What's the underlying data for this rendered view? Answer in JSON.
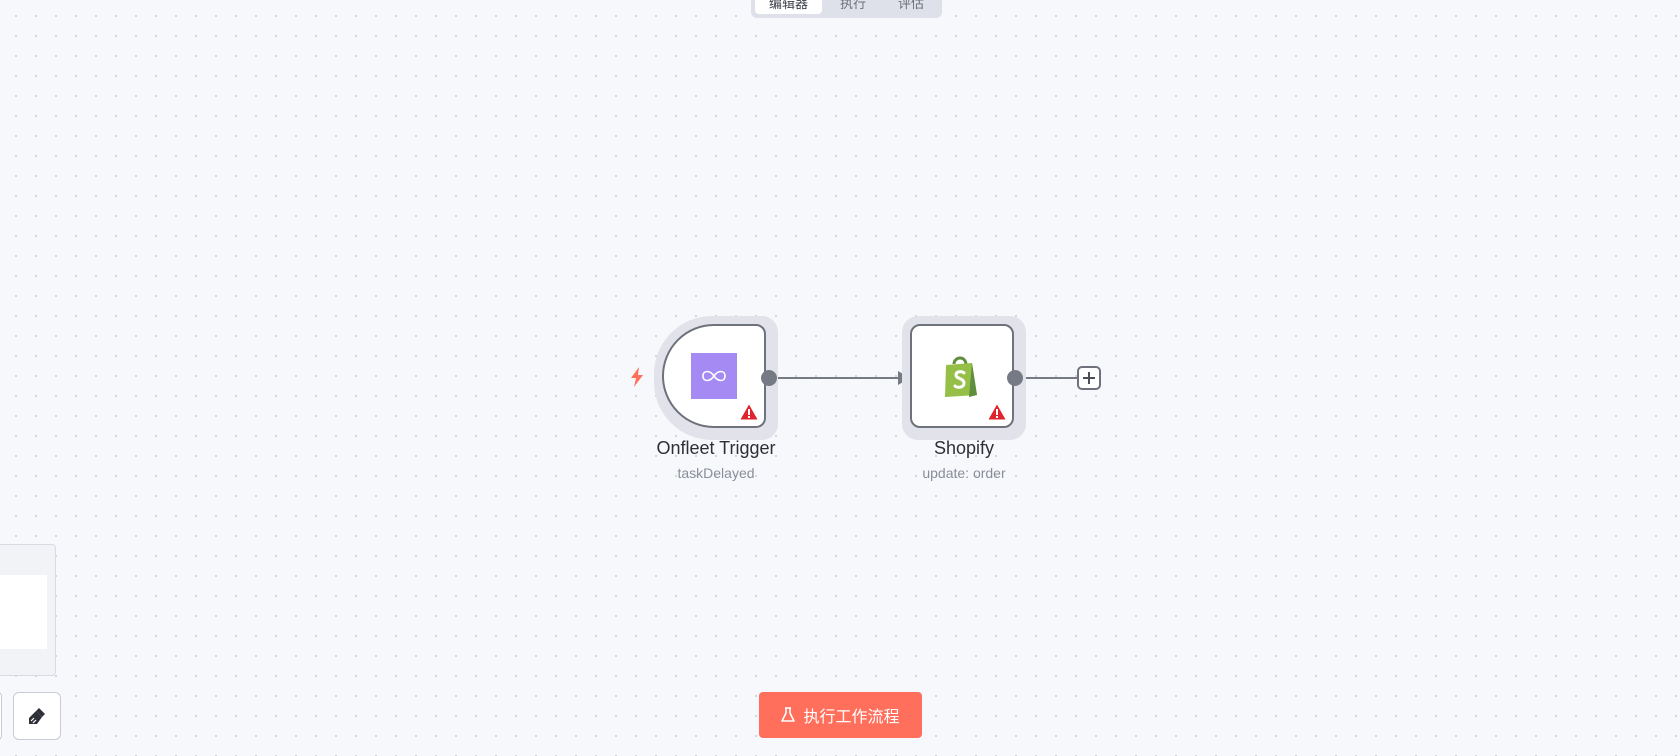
{
  "header": {
    "tabs": [
      {
        "label": "编辑器",
        "active": true
      },
      {
        "label": "执行",
        "active": false
      },
      {
        "label": "评估",
        "active": false
      }
    ]
  },
  "canvas": {
    "nodes": [
      {
        "title": "Onfleet Trigger",
        "subtitle": "taskDelayed",
        "icon": "onfleet-logo-icon",
        "kind": "trigger",
        "warning": true,
        "brand_color": "#a58af3"
      },
      {
        "title": "Shopify",
        "subtitle": "update: order",
        "icon": "shopify-logo-icon",
        "kind": "action",
        "warning": true,
        "brand_color": "#95bf47"
      }
    ],
    "connections": [
      {
        "from": "Onfleet Trigger",
        "to": "Shopify"
      }
    ]
  },
  "actions": {
    "run_workflow_label": "执行工作流程",
    "tidy_icon": "broom-icon",
    "add_node_icon": "plus-icon"
  },
  "colors": {
    "accent": "#ff6f5c",
    "warning": "#e0242e",
    "trigger_bolt": "#ff6f5c",
    "canvas_bg": "#f7f8fc"
  }
}
